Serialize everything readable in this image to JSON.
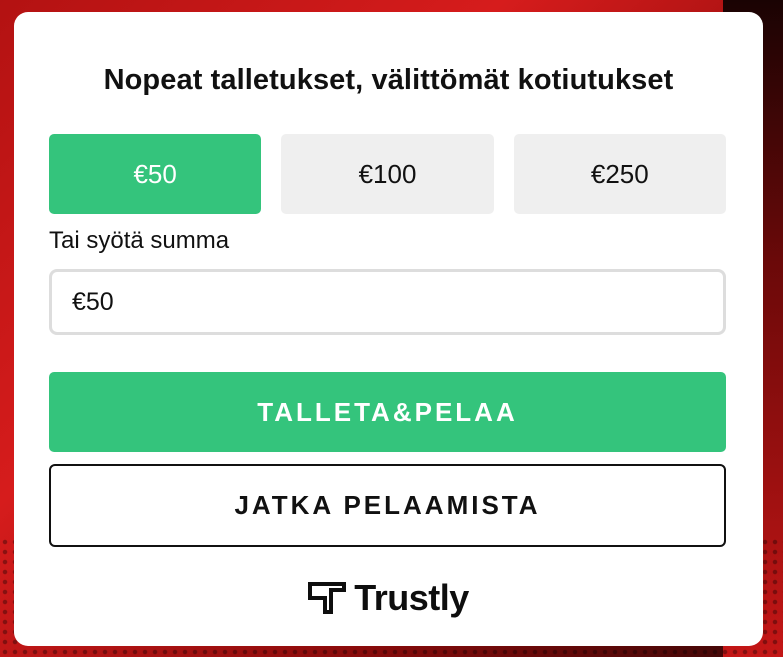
{
  "dialog": {
    "title": "Nopeat talletukset, välittömät kotiutukset",
    "amount_options": [
      {
        "label": "€50",
        "selected": true
      },
      {
        "label": "€100",
        "selected": false
      },
      {
        "label": "€250",
        "selected": false
      }
    ],
    "custom_amount_label": "Tai syötä summa",
    "custom_amount_value": "€50",
    "deposit_button_label": "TALLETA&PELAA",
    "continue_button_label": "JATKA PELAAMISTA",
    "brand": {
      "name": "Trustly",
      "icon": "trustly-logo-icon"
    }
  },
  "colors": {
    "accent": "#34c47c",
    "option_bg": "#efefef",
    "text": "#111111",
    "background": "#c41616"
  }
}
